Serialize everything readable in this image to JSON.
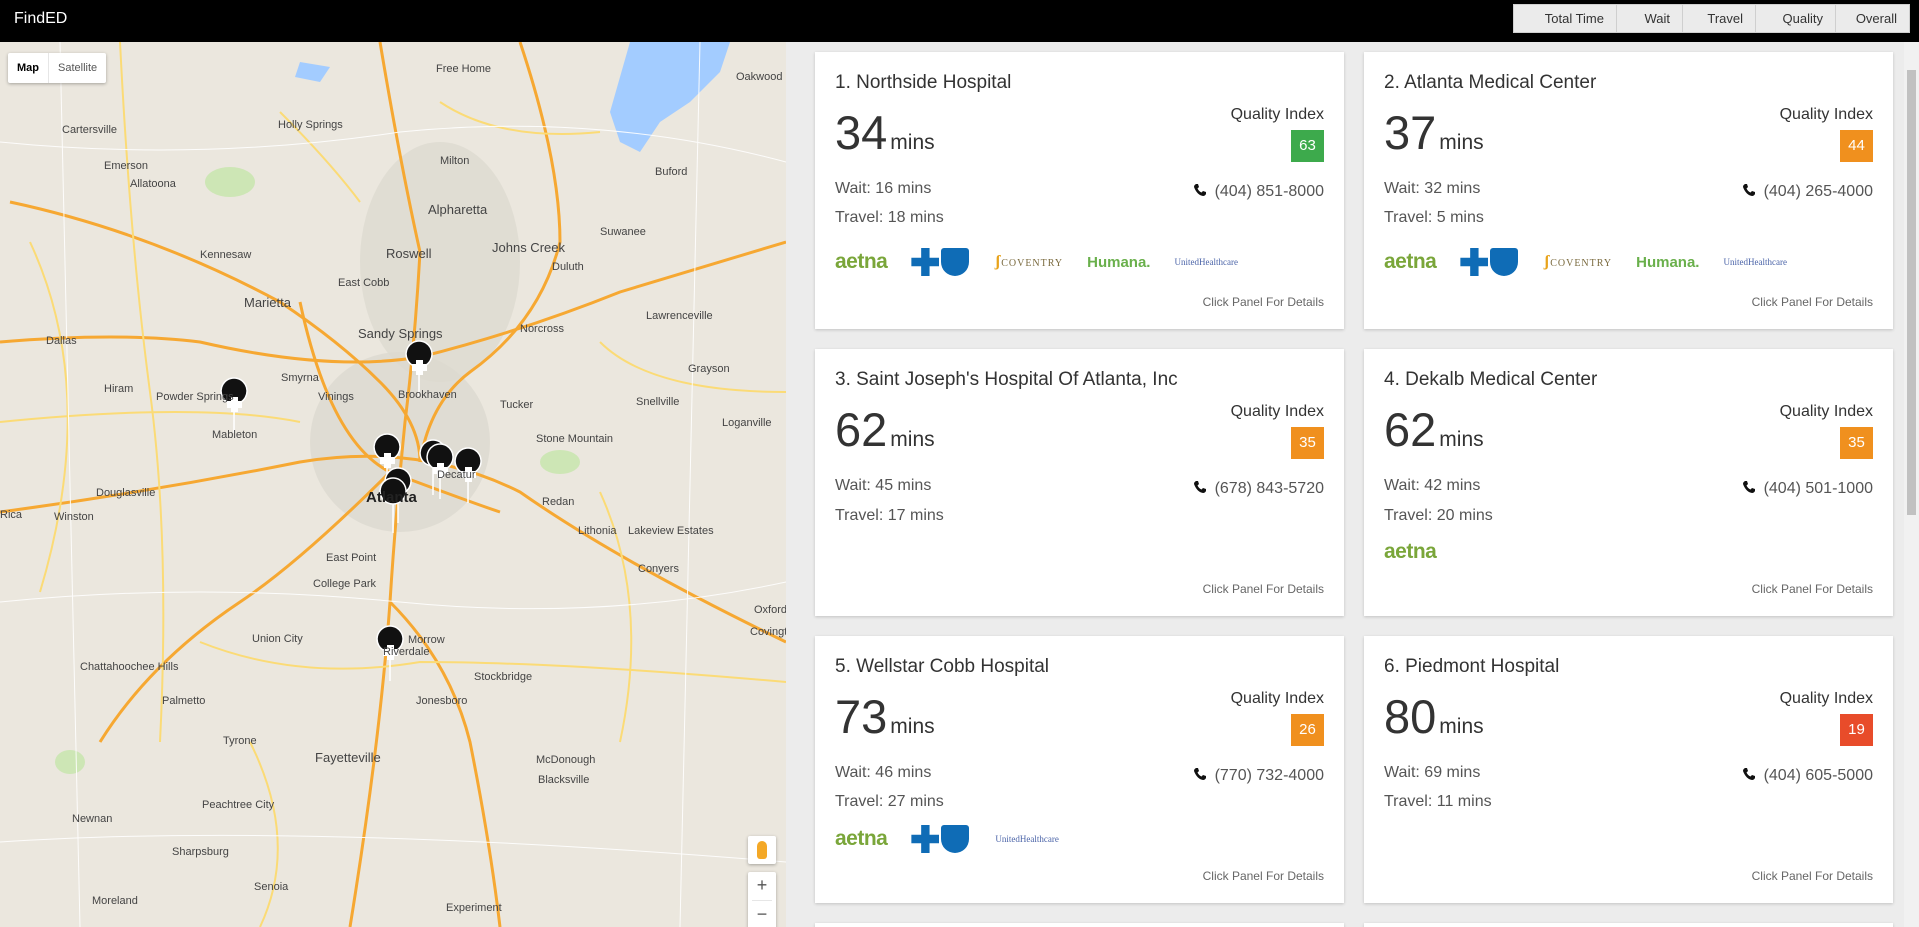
{
  "app": {
    "title": "FindED"
  },
  "sort": [
    {
      "label": "Total Time"
    },
    {
      "label": "Wait"
    },
    {
      "label": "Travel"
    },
    {
      "label": "Quality"
    },
    {
      "label": "Overall"
    }
  ],
  "map": {
    "type_map": "Map",
    "type_satellite": "Satellite",
    "labels": [
      "Cartersville",
      "Holly Springs",
      "Free Home",
      "Oakwood",
      "Emerson",
      "Allatoona",
      "Milton",
      "Buford",
      "Alpharetta",
      "Suwanee",
      "Kennesaw",
      "Roswell",
      "Johns Creek",
      "Duluth",
      "Marietta",
      "East Cobb",
      "Sandy Springs",
      "Norcross",
      "Lawrenceville",
      "Dallas",
      "Smyrna",
      "Grayson",
      "Hiram",
      "Powder Springs",
      "Vinings",
      "Brookhaven",
      "Tucker",
      "Snellville",
      "Mableton",
      "Loganville",
      "Stone Mountain",
      "Decatur",
      "Atlanta",
      "Douglasville",
      "Redan",
      "Winston",
      "Lithonia",
      "Lakeview Estates",
      "East Point",
      "Conyers",
      "College Park",
      "Union City",
      "Morrow",
      "Oxford",
      "Covington",
      "Chattahoochee Hills",
      "Riverdale",
      "Stockbridge",
      "Palmetto",
      "Jonesboro",
      "Tyrone",
      "Fayetteville",
      "McDonough",
      "Blacksville",
      "Peachtree City",
      "Newnan",
      "Sharpsburg",
      "Senoia",
      "Moreland",
      "Experiment",
      "Rica"
    ]
  },
  "cards": [
    {
      "name": "1. Northside Hospital",
      "time": "34",
      "unit": "mins",
      "quality_label": "Quality Index",
      "quality": "63",
      "quality_color": "#3daa4c",
      "wait": "Wait: 16 mins",
      "travel": "Travel: 18 mins",
      "phone": "(404) 851-8000",
      "details": "Click Panel For Details",
      "insurers": [
        "aetna",
        "bcbs",
        "coventry",
        "humana",
        "unitedhealthcare"
      ]
    },
    {
      "name": "2. Atlanta Medical Center",
      "time": "37",
      "unit": "mins",
      "quality_label": "Quality Index",
      "quality": "44",
      "quality_color": "#f0901e",
      "wait": "Wait: 32 mins",
      "travel": "Travel: 5 mins",
      "phone": "(404) 265-4000",
      "details": "Click Panel For Details",
      "insurers": [
        "aetna",
        "bcbs",
        "coventry",
        "humana",
        "unitedhealthcare"
      ]
    },
    {
      "name": "3. Saint Joseph's Hospital Of Atlanta, Inc",
      "time": "62",
      "unit": "mins",
      "quality_label": "Quality Index",
      "quality": "35",
      "quality_color": "#f0901e",
      "wait": "Wait: 45 mins",
      "travel": "Travel: 17 mins",
      "phone": "(678) 843-5720",
      "details": "Click Panel For Details",
      "insurers": []
    },
    {
      "name": "4. Dekalb Medical Center",
      "time": "62",
      "unit": "mins",
      "quality_label": "Quality Index",
      "quality": "35",
      "quality_color": "#f0901e",
      "wait": "Wait: 42 mins",
      "travel": "Travel: 20 mins",
      "phone": "(404) 501-1000",
      "details": "Click Panel For Details",
      "insurers": [
        "aetna"
      ]
    },
    {
      "name": "5. Wellstar Cobb Hospital",
      "time": "73",
      "unit": "mins",
      "quality_label": "Quality Index",
      "quality": "26",
      "quality_color": "#f0901e",
      "wait": "Wait: 46 mins",
      "travel": "Travel: 27 mins",
      "phone": "(770) 732-4000",
      "details": "Click Panel For Details",
      "insurers": [
        "aetna",
        "bcbs",
        "unitedhealthcare"
      ]
    },
    {
      "name": "6. Piedmont Hospital",
      "time": "80",
      "unit": "mins",
      "quality_label": "Quality Index",
      "quality": "19",
      "quality_color": "#e84c2a",
      "wait": "Wait: 69 mins",
      "travel": "Travel: 11 mins",
      "phone": "(404) 605-5000",
      "details": "Click Panel For Details",
      "insurers": []
    }
  ],
  "logos": {
    "aetna": "aetna",
    "coventry": "COVENTRY",
    "humana": "Humana.",
    "unitedhealthcare": "UnitedHealthcare"
  }
}
